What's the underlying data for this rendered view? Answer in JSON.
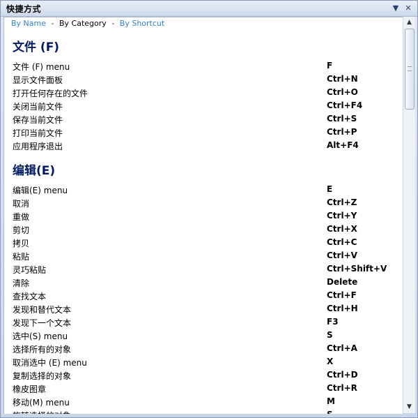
{
  "window": {
    "title": "快捷方式",
    "controls": {
      "dropdown_icon": "chevron-down-icon",
      "close_icon": "close-icon"
    }
  },
  "nav": {
    "by_name": "By Name",
    "separator": "-",
    "by_category": "By Category",
    "by_shortcut": "By Shortcut"
  },
  "sections": [
    {
      "heading": "文件 (F)",
      "rows": [
        {
          "label": "文件 (F) menu",
          "key": "F"
        },
        {
          "label": "显示文件面板",
          "key": "Ctrl+N"
        },
        {
          "label": "打开任何存在的文件",
          "key": "Ctrl+O"
        },
        {
          "label": "关闭当前文件",
          "key": "Ctrl+F4"
        },
        {
          "label": "保存当前文件",
          "key": "Ctrl+S"
        },
        {
          "label": "打印当前文件",
          "key": "Ctrl+P"
        },
        {
          "label": "应用程序退出",
          "key": "Alt+F4"
        }
      ]
    },
    {
      "heading": "编辑(E)",
      "rows": [
        {
          "label": "编辑(E) menu",
          "key": "E"
        },
        {
          "label": "取消",
          "key": "Ctrl+Z"
        },
        {
          "label": "重做",
          "key": "Ctrl+Y"
        },
        {
          "label": "剪切",
          "key": "Ctrl+X"
        },
        {
          "label": "拷贝",
          "key": "Ctrl+C"
        },
        {
          "label": "粘贴",
          "key": "Ctrl+V"
        },
        {
          "label": "灵巧粘贴",
          "key": "Ctrl+Shift+V"
        },
        {
          "label": "清除",
          "key": "Delete"
        },
        {
          "label": "查找文本",
          "key": "Ctrl+F"
        },
        {
          "label": "发现和替代文本",
          "key": "Ctrl+H"
        },
        {
          "label": "发现下一个文本",
          "key": "F3"
        },
        {
          "label": "选中(S) menu",
          "key": "S"
        },
        {
          "label": "选择所有的对象",
          "key": "Ctrl+A"
        },
        {
          "label": "取消选中 (E) menu",
          "key": "X"
        },
        {
          "label": "复制选择的对象",
          "key": "Ctrl+D"
        },
        {
          "label": "橡皮图章",
          "key": "Ctrl+R"
        },
        {
          "label": "移动(M) menu",
          "key": "M"
        },
        {
          "label": "旋转选择的对象",
          "key": "S"
        }
      ]
    }
  ],
  "scrollbar": {
    "up_icon": "arrow-up-icon",
    "down_icon": "arrow-down-icon"
  }
}
